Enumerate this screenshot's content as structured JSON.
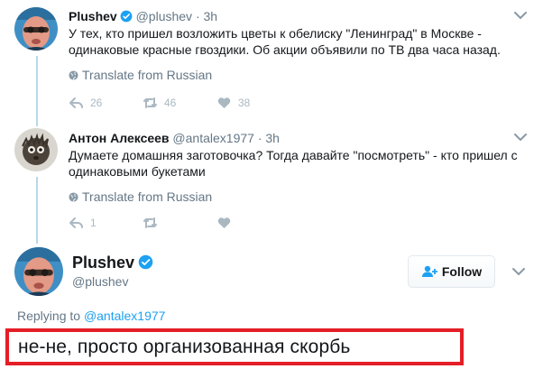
{
  "colors": {
    "accent": "#1da1f2",
    "muted": "#657786",
    "icon": "#aab8c2",
    "highlight": "#e41e26"
  },
  "tweet1": {
    "name": "Plushev",
    "handle": "@plushev",
    "dot": "·",
    "time": "3h",
    "text": "У тех, кто пришел возложить цветы к обелиску \"Ленинград\" в Москве - одинаковые красные гвоздики. Об акции объявили по ТВ два часа назад.",
    "translate": "Translate from Russian",
    "reply_count": "26",
    "retweet_count": "46",
    "like_count": "38"
  },
  "tweet2": {
    "name": "Антон Алексеев",
    "handle": "@antalex1977",
    "dot": "·",
    "time": "3h",
    "text": "Думаете домашняя заготовочка? Тогда давайте \"посмотреть\" - кто пришел с одинаковыми букетами",
    "translate": "Translate from Russian",
    "reply_count": "1",
    "retweet_count": "",
    "like_count": ""
  },
  "main": {
    "name": "Plushev",
    "handle": "@plushev",
    "follow_label": "Follow",
    "replying_prefix": "Replying to",
    "replying_handle": "@antalex1977",
    "reply_text": "не-не, просто организованная скорбь"
  }
}
